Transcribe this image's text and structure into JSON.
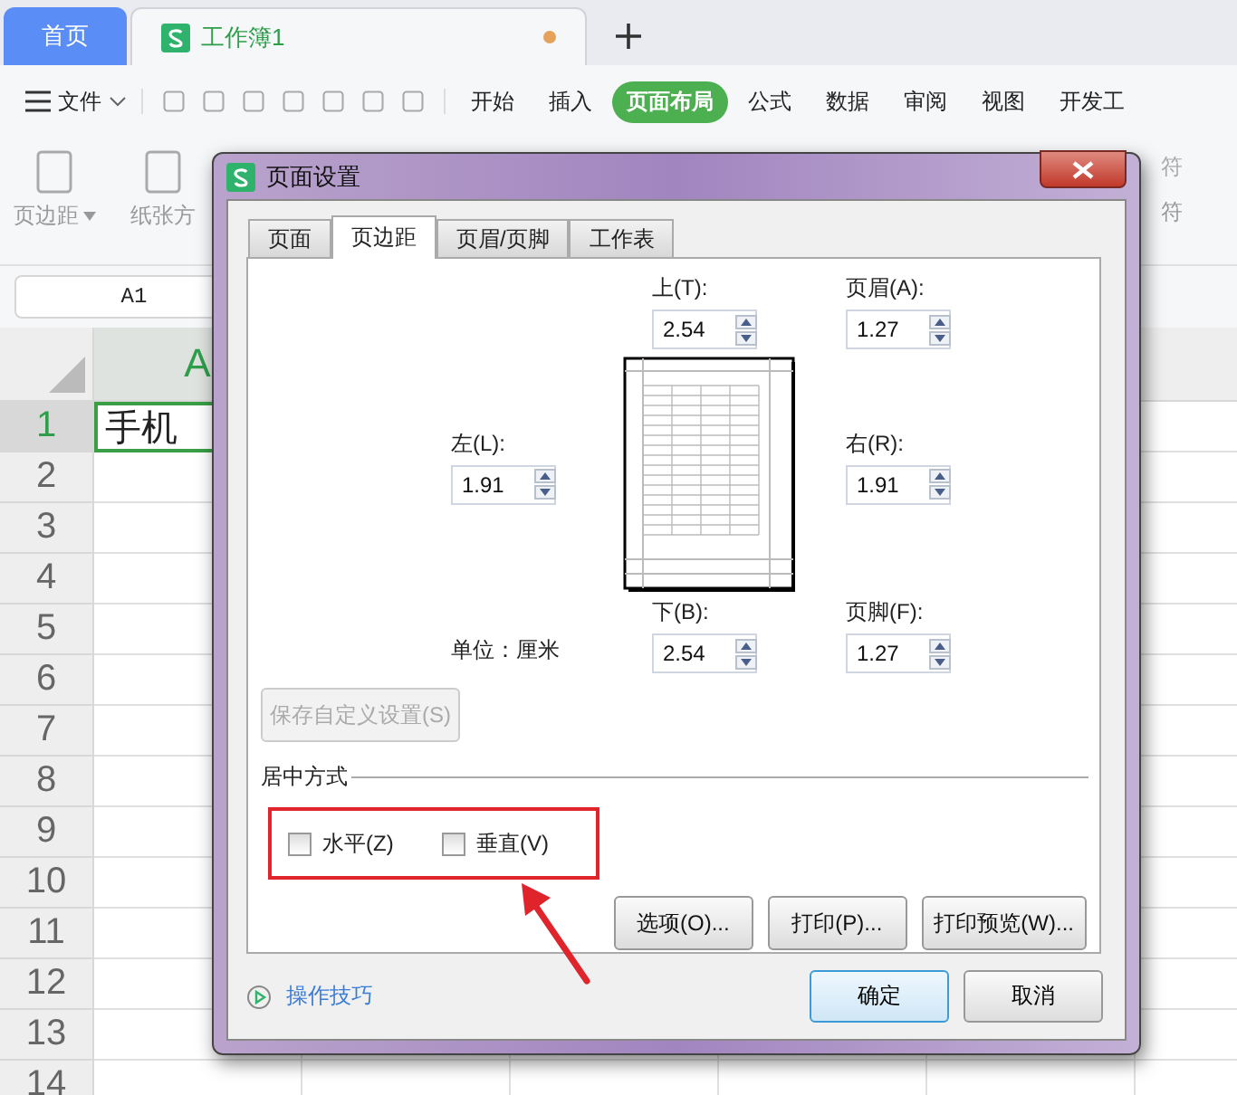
{
  "app_tabs": [
    {
      "label": "首页",
      "selected": false,
      "unsaved": false
    },
    {
      "label": "工作簿1",
      "selected": true,
      "unsaved": true
    }
  ],
  "file_menu": "文件",
  "menu_tabs": [
    {
      "label": "开始",
      "selected": false
    },
    {
      "label": "插入",
      "selected": false
    },
    {
      "label": "页面布局",
      "selected": true
    },
    {
      "label": "公式",
      "selected": false
    },
    {
      "label": "数据",
      "selected": false
    },
    {
      "label": "审阅",
      "selected": false
    },
    {
      "label": "视图",
      "selected": false
    },
    {
      "label": "开发工",
      "selected": false
    }
  ],
  "ribbon": {
    "left": [
      "页边距",
      "纸张方"
    ],
    "right_top": "符",
    "right_bottom": "符"
  },
  "name_box": "A1",
  "columns": [
    {
      "label": "A",
      "selected": true
    }
  ],
  "rows": [
    {
      "label": "1",
      "selected": true,
      "cell": "手机"
    },
    {
      "label": "2",
      "selected": false
    },
    {
      "label": "3",
      "selected": false
    },
    {
      "label": "4",
      "selected": false
    },
    {
      "label": "5",
      "selected": false
    },
    {
      "label": "6",
      "selected": false
    },
    {
      "label": "7",
      "selected": false
    },
    {
      "label": "8",
      "selected": false
    },
    {
      "label": "9",
      "selected": false
    },
    {
      "label": "10",
      "selected": false
    },
    {
      "label": "11",
      "selected": false
    },
    {
      "label": "12",
      "selected": false
    },
    {
      "label": "13",
      "selected": false
    },
    {
      "label": "14",
      "selected": false
    }
  ],
  "dialog": {
    "title": "页面设置",
    "tabs": [
      {
        "label": "页面",
        "selected": false
      },
      {
        "label": "页边距",
        "selected": true
      },
      {
        "label": "页眉/页脚",
        "selected": false
      },
      {
        "label": "工作表",
        "selected": false
      }
    ],
    "margins": {
      "top": {
        "label": "上(T):",
        "value": "2.54"
      },
      "header": {
        "label": "页眉(A):",
        "value": "1.27"
      },
      "left": {
        "label": "左(L):",
        "value": "1.91"
      },
      "right": {
        "label": "右(R):",
        "value": "1.91"
      },
      "bottom": {
        "label": "下(B):",
        "value": "2.54"
      },
      "footer": {
        "label": "页脚(F):",
        "value": "1.27"
      }
    },
    "unit_label": "单位：厘米",
    "save_button": {
      "label": "保存自定义设置(S)",
      "disabled": true
    },
    "centering": {
      "title": "居中方式",
      "highlighted": true,
      "options": [
        {
          "label": "水平(Z)",
          "checked": false
        },
        {
          "label": "垂直(V)",
          "checked": false
        }
      ]
    },
    "action_buttons": [
      "选项(O)...",
      "打印(P)...",
      "打印预览(W)..."
    ],
    "tips_link": "操作技巧",
    "ok_button": "确定",
    "cancel_button": "取消"
  }
}
